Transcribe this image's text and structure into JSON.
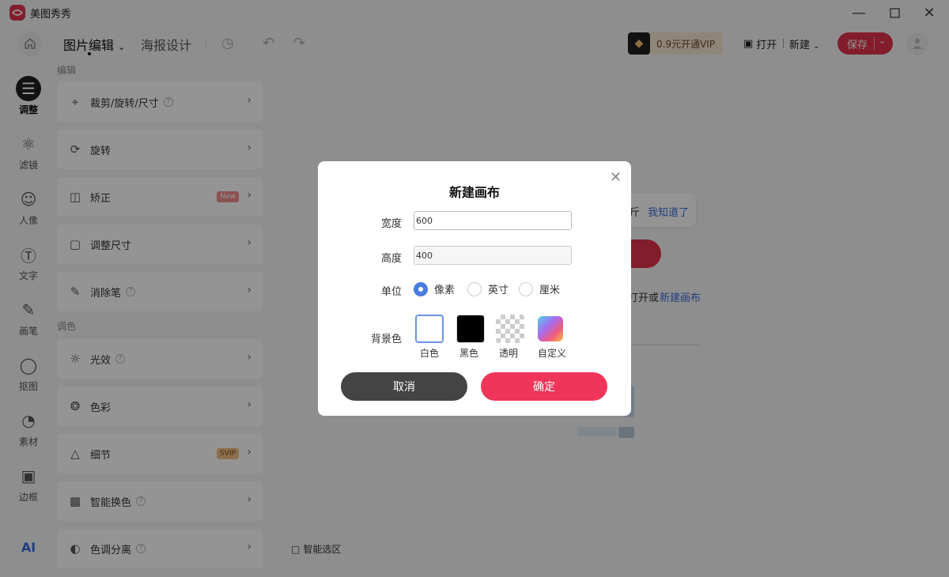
{
  "app": {
    "name": "美图秀秀"
  },
  "toolbar": {
    "tab_photo_edit": "图片编辑",
    "tab_poster": "海报设计",
    "vip_label": "0.9元开通VIP",
    "open_label": "打开",
    "new_label": "新建",
    "save_label": "保存"
  },
  "rail": [
    {
      "label": "调整",
      "icon": "adjust-icon"
    },
    {
      "label": "滤镜",
      "icon": "filter-icon"
    },
    {
      "label": "人像",
      "icon": "portrait-icon"
    },
    {
      "label": "文字",
      "icon": "text-icon"
    },
    {
      "label": "画笔",
      "icon": "brush-icon"
    },
    {
      "label": "抠图",
      "icon": "cutout-icon"
    },
    {
      "label": "素材",
      "icon": "sticker-icon"
    },
    {
      "label": "边框",
      "icon": "frame-icon"
    },
    {
      "label": "AI",
      "icon": "ai-icon"
    }
  ],
  "panel": {
    "section_edit": "编辑",
    "section_color": "调色",
    "items": [
      {
        "label": "裁剪/旋转/尺寸",
        "help": true,
        "badge": ""
      },
      {
        "label": "旋转",
        "help": false,
        "badge": ""
      },
      {
        "label": "矫正",
        "help": false,
        "badge": "New"
      },
      {
        "label": "调整尺寸",
        "help": false,
        "badge": ""
      },
      {
        "label": "消除笔",
        "help": true,
        "badge": ""
      },
      {
        "label": "光效",
        "help": true,
        "badge": ""
      },
      {
        "label": "色彩",
        "help": false,
        "badge": ""
      },
      {
        "label": "细节",
        "help": false,
        "badge": "SVIP"
      },
      {
        "label": "智能换色",
        "help": true,
        "badge": ""
      },
      {
        "label": "色调分离",
        "help": true,
        "badge": ""
      }
    ]
  },
  "canvas": {
    "hint_prefix": "斤",
    "hint_link": "我知道了",
    "open_text": "打开或",
    "open_link": "新建画布",
    "smart_select": "智能选区"
  },
  "modal": {
    "title": "新建画布",
    "width_label": "宽度",
    "width_value": "600",
    "height_label": "高度",
    "height_value": "400",
    "unit_label": "单位",
    "units": [
      "像素",
      "英寸",
      "厘米"
    ],
    "selected_unit": "像素",
    "bg_label": "背景色",
    "bg_options": [
      "白色",
      "黑色",
      "透明",
      "自定义"
    ],
    "selected_bg": "白色",
    "cancel_label": "取消",
    "ok_label": "确定"
  }
}
